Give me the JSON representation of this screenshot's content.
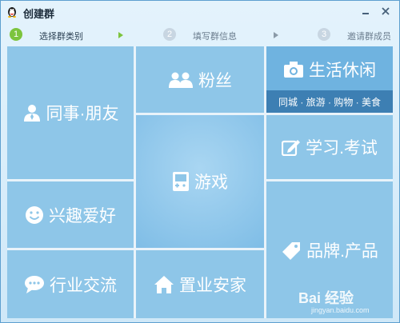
{
  "window": {
    "title": "创建群"
  },
  "steps": [
    {
      "num": "1",
      "label": "选择群类别"
    },
    {
      "num": "2",
      "label": "填写群信息"
    },
    {
      "num": "3",
      "label": "邀请群成员"
    }
  ],
  "tiles": {
    "colleagues_friends": {
      "label": "同事·朋友",
      "icon": "person-icon"
    },
    "fans": {
      "label": "粉丝",
      "icon": "group-icon"
    },
    "leisure": {
      "label": "生活休闲",
      "icon": "camera-icon",
      "subtitle": "同城 · 旅游 · 购物 · 美食"
    },
    "hobbies": {
      "label": "兴趣爱好",
      "icon": "smile-icon"
    },
    "games": {
      "label": "游戏",
      "icon": "gamepad-icon"
    },
    "study_exam": {
      "label": "学习.考试",
      "icon": "edit-icon"
    },
    "brand_product": {
      "label": "品牌.产品",
      "icon": "tag-icon"
    },
    "industry": {
      "label": "行业交流",
      "icon": "chat-icon"
    },
    "real_estate": {
      "label": "置业安家",
      "icon": "home-icon"
    }
  },
  "watermark": {
    "main": "Bai 经验",
    "sub": "jingyan.baidu.com"
  },
  "colors": {
    "tile": "#8ec6e8",
    "tile_dark": "#6fb3e0",
    "subbar": "#3d7fb3",
    "step_active": "#7cc43d"
  }
}
